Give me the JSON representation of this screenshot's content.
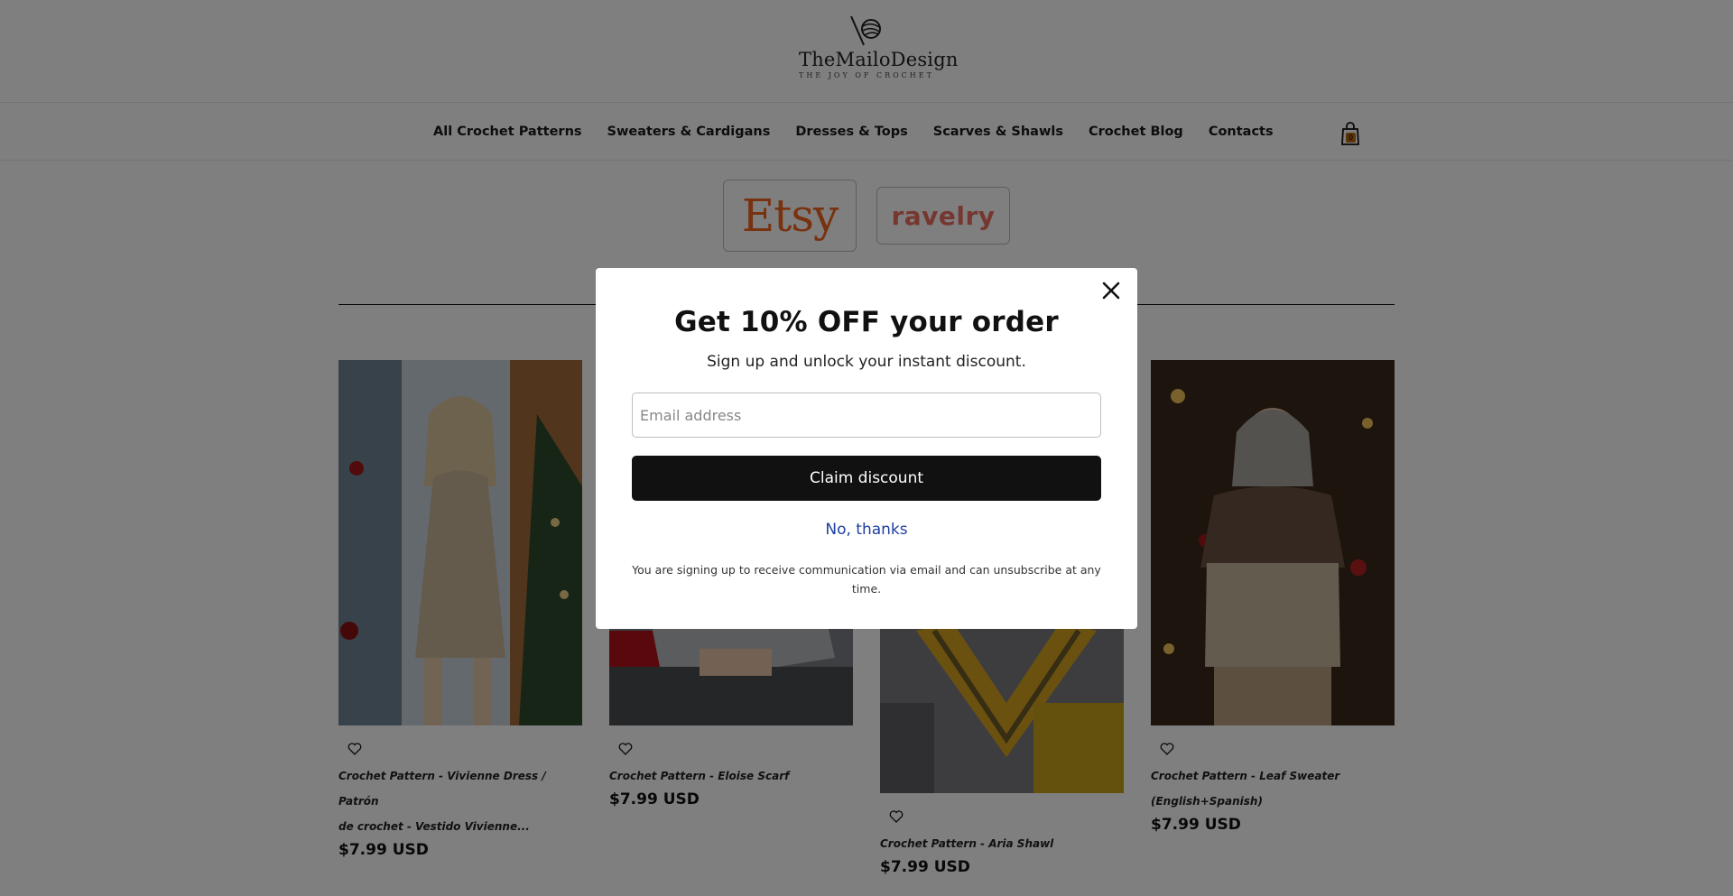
{
  "brand": {
    "name": "TheMailoDesign",
    "tagline": "THE JOY OF CROCHET"
  },
  "nav": {
    "items": [
      {
        "label": "All Crochet Patterns"
      },
      {
        "label": "Sweaters & Cardigans"
      },
      {
        "label": "Dresses & Tops"
      },
      {
        "label": "Scarves & Shawls"
      },
      {
        "label": "Crochet Blog"
      },
      {
        "label": "Contacts"
      }
    ],
    "cart_count": "0",
    "cart_icon": "shopping-bag-icon"
  },
  "marketplaces": {
    "etsy": "Etsy",
    "ravelry": "ravelry"
  },
  "products": [
    {
      "title_line1": "Crochet Pattern - Vivienne Dress / Patrón",
      "title_line2": "de crochet - Vestido Vivienne...",
      "price": "$7.99 USD"
    },
    {
      "title_line1": "Crochet Pattern - Eloise Scarf",
      "title_line2": "",
      "price": "$7.99 USD"
    },
    {
      "title_line1": "Crochet Pattern - Aria Shawl",
      "title_line2": "",
      "price": "$7.99 USD"
    },
    {
      "title_line1": "Crochet Pattern - Leaf Sweater",
      "title_line2": "(English+Spanish)",
      "price": "$7.99 USD"
    }
  ],
  "popup": {
    "title": "Get 10% OFF your order",
    "subtitle": "Sign up and unlock your instant discount.",
    "email_placeholder": "Email address",
    "claim_label": "Claim discount",
    "decline_label": "No, thanks",
    "legal": "You are signing up to receive communication via email and can unsubscribe at any time."
  },
  "colors": {
    "etsy": "#f1641e",
    "ravelry": "#ee6e62",
    "button": "#111111",
    "link": "#1f3fa0",
    "overlay": "rgba(0,0,0,0.5)"
  }
}
